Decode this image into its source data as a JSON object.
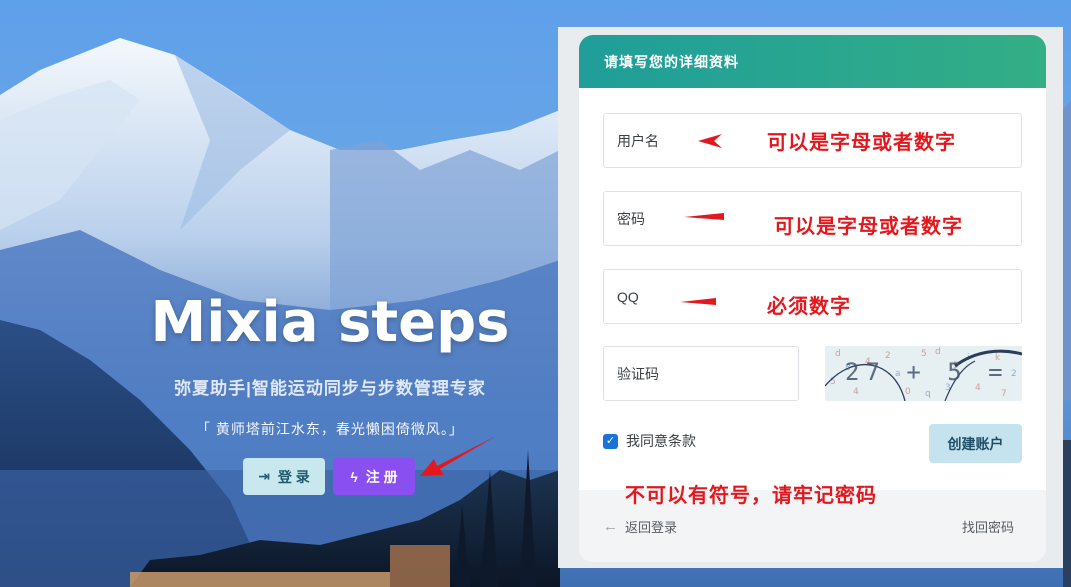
{
  "hero": {
    "title": "Mixia steps",
    "subtitle": "弥夏助手|智能运动同步与步数管理专家",
    "quote": "「 黄师塔前江水东，春光懒困倚微风。」",
    "login_label": "登 录",
    "register_label": "注 册"
  },
  "form": {
    "header": "请填写您的详细资料",
    "username_placeholder": "用户名",
    "password_placeholder": "密码",
    "qq_placeholder": "QQ",
    "captcha_placeholder": "验证码",
    "captcha_text": "27 + 5 =",
    "agree_label": "我同意条款",
    "agree_checked": true,
    "create_button": "创建账户",
    "back_label": "返回登录",
    "forgot_label": "找回密码"
  },
  "annotations": {
    "username_note": "可以是字母或者数字",
    "password_note": "可以是字母或者数字",
    "qq_note": "必须数字",
    "general_note": "不可以有符号，请牢记密码",
    "color": "#e3181f"
  },
  "colors": {
    "header_gradient_start": "#1f9e9a",
    "header_gradient_end": "#33ae85",
    "register_button": "#8a4ff0",
    "login_button": "#c9e7ee",
    "create_button": "#c5e3ef"
  }
}
